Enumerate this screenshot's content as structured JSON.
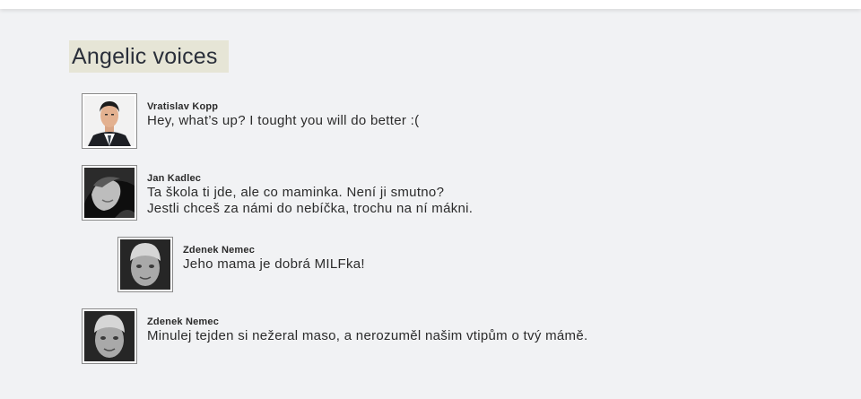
{
  "section": {
    "title": "Angelic voices"
  },
  "comments": [
    {
      "author": "Vratislav Kopp",
      "lines": [
        "Hey, what’s up? I tought you will do better :("
      ],
      "avatar_icon": "portrait-suit-icon"
    },
    {
      "author": "Jan Kadlec",
      "lines": [
        "Ta škola ti jde, ale co maminka. Není ji smutno?",
        "Jestli chceš za námi do nebíčka, trochu na ní mákni."
      ],
      "avatar_icon": "portrait-bw-side-icon"
    },
    {
      "author": "Zdenek Nemec",
      "lines": [
        "Jeho mama je dobrá MILFka!"
      ],
      "avatar_icon": "portrait-beanie-icon",
      "reply": true
    },
    {
      "author": "Zdenek Nemec",
      "lines": [
        "Minulej tejden si nežeral maso, a nerozuměl našim vtipům o tvý mámě."
      ],
      "avatar_icon": "portrait-beanie-icon"
    }
  ]
}
